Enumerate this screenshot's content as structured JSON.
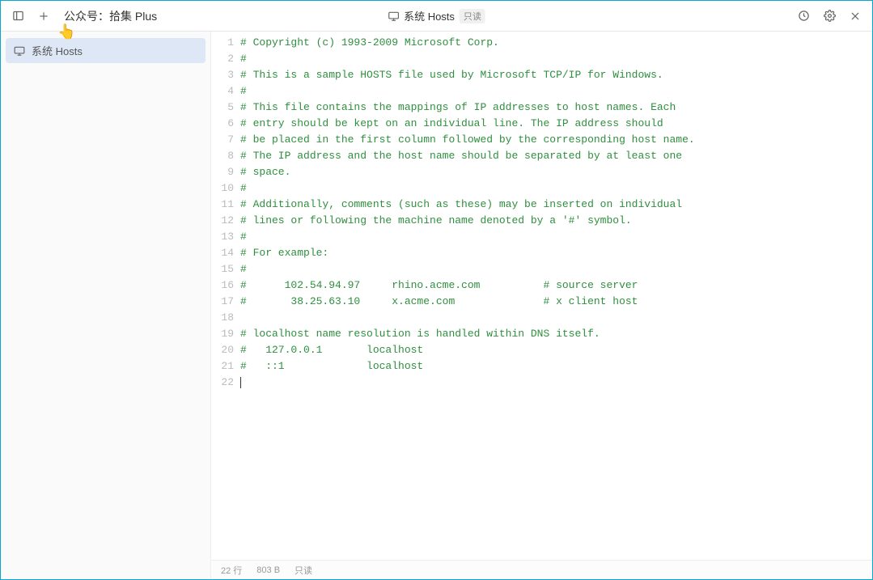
{
  "titlebar": {
    "app_title": "公众号：拾集 Plus",
    "center_label": "系统 Hosts",
    "readonly_badge": "只读"
  },
  "sidebar": {
    "items": [
      {
        "label": "系统 Hosts"
      }
    ]
  },
  "editor": {
    "lines": [
      "# Copyright (c) 1993-2009 Microsoft Corp.",
      "#",
      "# This is a sample HOSTS file used by Microsoft TCP/IP for Windows.",
      "#",
      "# This file contains the mappings of IP addresses to host names. Each",
      "# entry should be kept on an individual line. The IP address should",
      "# be placed in the first column followed by the corresponding host name.",
      "# The IP address and the host name should be separated by at least one",
      "# space.",
      "#",
      "# Additionally, comments (such as these) may be inserted on individual",
      "# lines or following the machine name denoted by a '#' symbol.",
      "#",
      "# For example:",
      "#",
      "#      102.54.94.97     rhino.acme.com          # source server",
      "#       38.25.63.10     x.acme.com              # x client host",
      "",
      "# localhost name resolution is handled within DNS itself.",
      "#   127.0.0.1       localhost",
      "#   ::1             localhost",
      ""
    ]
  },
  "statusbar": {
    "lines": "22 行",
    "bytes": "803 B",
    "mode": "只读"
  }
}
